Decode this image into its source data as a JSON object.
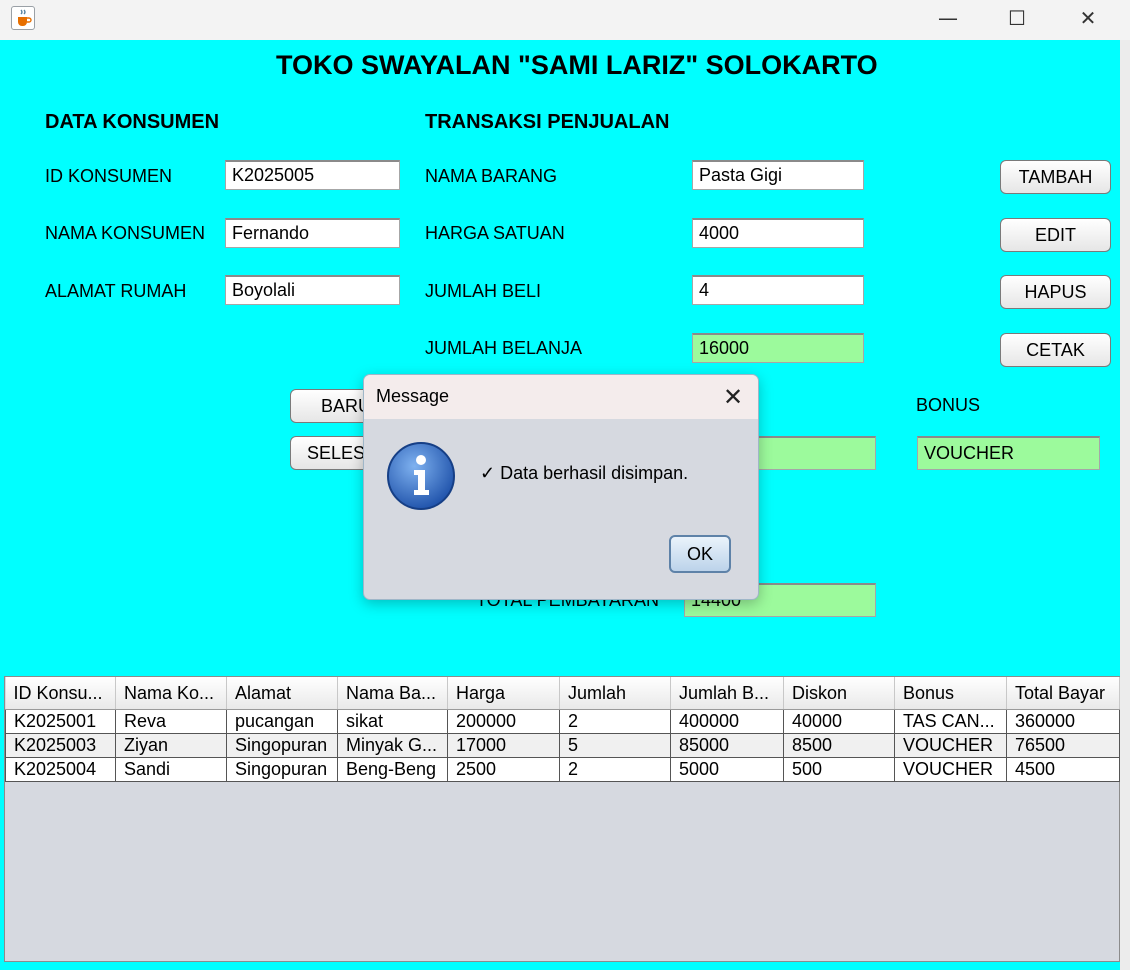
{
  "window": {
    "app_icon": "java-cup-icon",
    "minimize_glyph": "—",
    "maximize_glyph": "☐",
    "close_glyph": "✕"
  },
  "header": {
    "title": "TOKO SWAYALAN \"SAMI LARIZ\" SOLOKARTO"
  },
  "konsumen": {
    "heading": "DATA KONSUMEN",
    "id_label": "ID KONSUMEN",
    "id_value": "K2025005",
    "nama_label": "NAMA KONSUMEN",
    "nama_value": "Fernando",
    "alamat_label": "ALAMAT RUMAH",
    "alamat_value": "Boyolali"
  },
  "transaksi": {
    "heading": "TRANSAKSI PENJUALAN",
    "barang_label": "NAMA BARANG",
    "barang_value": "Pasta Gigi",
    "harga_label": "HARGA SATUAN",
    "harga_value": "4000",
    "jumlah_beli_label": "JUMLAH BELI",
    "jumlah_beli_value": "4",
    "jumlah_belanja_label": "JUMLAH BELANJA",
    "jumlah_belanja_value": "16000",
    "bonus_label": "BONUS",
    "bonus_value": "VOUCHER",
    "total_label": "TOTAL PEMBAYARAN",
    "total_value": "14400"
  },
  "buttons": {
    "tambah": "TAMBAH",
    "edit": "EDIT",
    "hapus": "HAPUS",
    "cetak": "CETAK",
    "baru": "BARU",
    "selesai": "SELES"
  },
  "table": {
    "columns": [
      "ID Konsu...",
      "Nama Ko...",
      "Alamat",
      "Nama Ba...",
      "Harga",
      "Jumlah",
      "Jumlah B...",
      "Diskon",
      "Bonus",
      "Total Bayar"
    ],
    "rows": [
      [
        "K2025001",
        "Reva",
        "pucangan",
        "sikat",
        "200000",
        "2",
        "400000",
        "40000",
        "TAS CAN...",
        "360000"
      ],
      [
        "K2025003",
        "Ziyan",
        "Singopuran",
        "Minyak G...",
        "17000",
        "5",
        "85000",
        "8500",
        "VOUCHER",
        "76500"
      ],
      [
        "K2025004",
        "Sandi",
        "Singopuran",
        "Beng-Beng",
        "2500",
        "2",
        "5000",
        "500",
        "VOUCHER",
        "4500"
      ]
    ]
  },
  "dialog": {
    "title": "Message",
    "message": "✓ Data berhasil disimpan.",
    "ok_label": "OK",
    "close_glyph": "✕",
    "icon": "info-icon"
  }
}
